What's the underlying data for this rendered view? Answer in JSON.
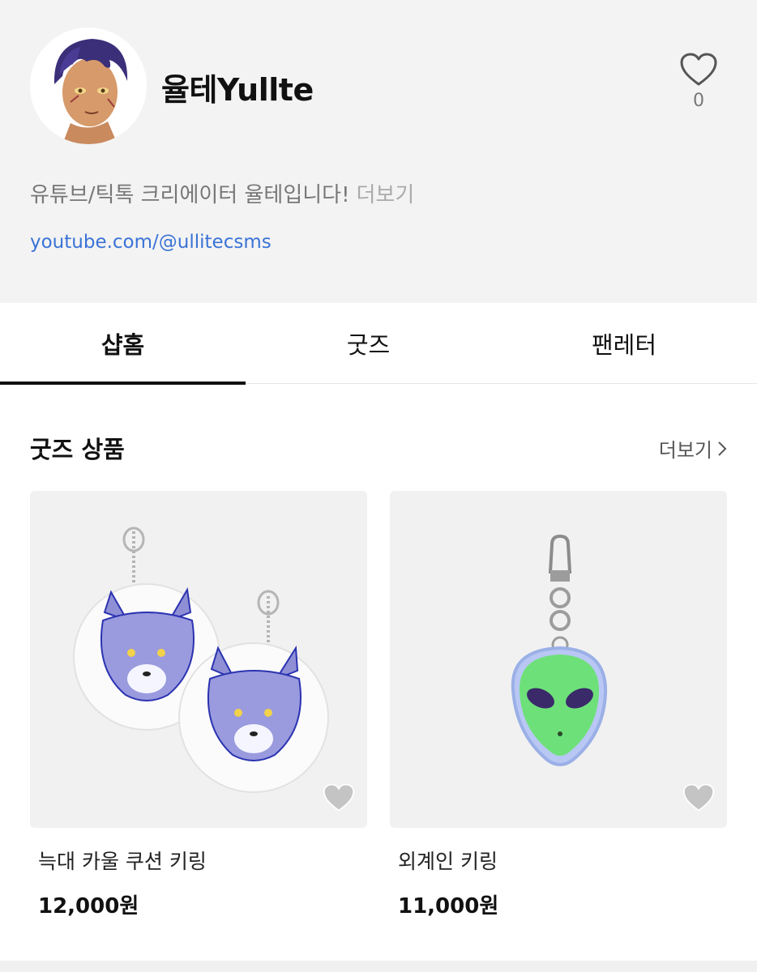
{
  "profile": {
    "name": "율테Yullte",
    "like_count": "0",
    "bio": "유튜브/틱톡 크리에이터 율테입니다!",
    "bio_more": "더보기",
    "link": "youtube.com/@ullitecsms",
    "avatar_icon": "avatar-portrait"
  },
  "tabs": [
    {
      "label": "샵홈",
      "active": true
    },
    {
      "label": "굿즈",
      "active": false
    },
    {
      "label": "팬레터",
      "active": false
    }
  ],
  "section": {
    "title": "굿즈 상품",
    "more": "더보기"
  },
  "products": [
    {
      "name": "늑대 카울 쿠션 키링",
      "price": "12,000원",
      "icon": "wolf-cushion-keyring"
    },
    {
      "name": "외계인 키링",
      "price": "11,000원",
      "icon": "alien-acrylic-keyring"
    }
  ],
  "colors": {
    "profile_bg": "#f3f3f3",
    "link": "#3a73d6",
    "thumb_bg": "#f1f1f1"
  }
}
